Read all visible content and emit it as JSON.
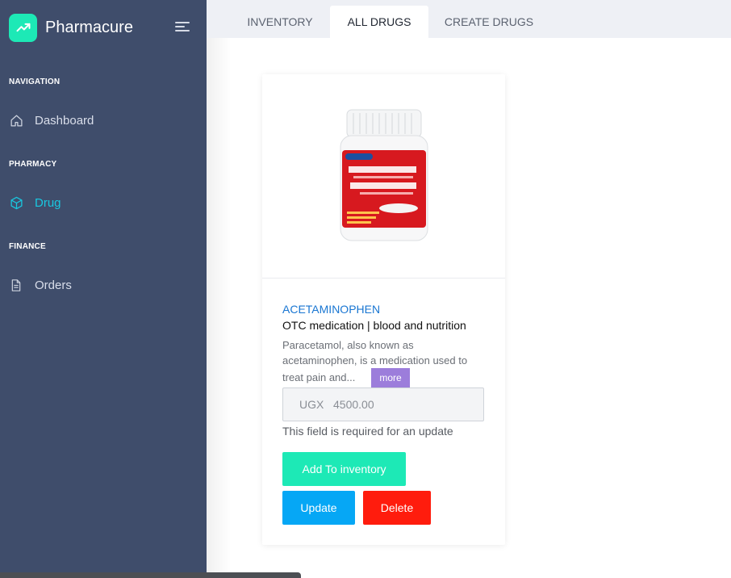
{
  "brand": {
    "name": "Pharmacure",
    "logo_icon": "trending-up-icon",
    "accent_color": "#1de9b6"
  },
  "sidebar": {
    "sections": [
      {
        "title": "NAVIGATION",
        "items": [
          {
            "label": "Dashboard",
            "icon": "home-icon",
            "active": false
          }
        ]
      },
      {
        "title": "PHARMACY",
        "items": [
          {
            "label": "Drug",
            "icon": "cube-icon",
            "active": true
          }
        ]
      },
      {
        "title": "FINANCE",
        "items": [
          {
            "label": "Orders",
            "icon": "document-icon",
            "active": false
          }
        ]
      }
    ],
    "background": "#3f4d6b",
    "active_color": "#19c8e0"
  },
  "tabs": [
    {
      "label": "INVENTORY",
      "active": false
    },
    {
      "label": "ALL DRUGS",
      "active": true
    },
    {
      "label": "CREATE DRUGS",
      "active": false
    }
  ],
  "drug_card": {
    "name": "ACETAMINOPHEN",
    "category": "OTC medication | blood and nutrition",
    "description": "Paracetamol, also known as acetaminophen, is a medication used to treat pain and...",
    "more_label": "more",
    "price_placeholder": "UGX   4500.00",
    "helper_text": "This field is required for an update",
    "add_label": "Add To inventory",
    "update_label": "Update",
    "delete_label": "Delete",
    "image": "acetaminophen-bottle"
  }
}
